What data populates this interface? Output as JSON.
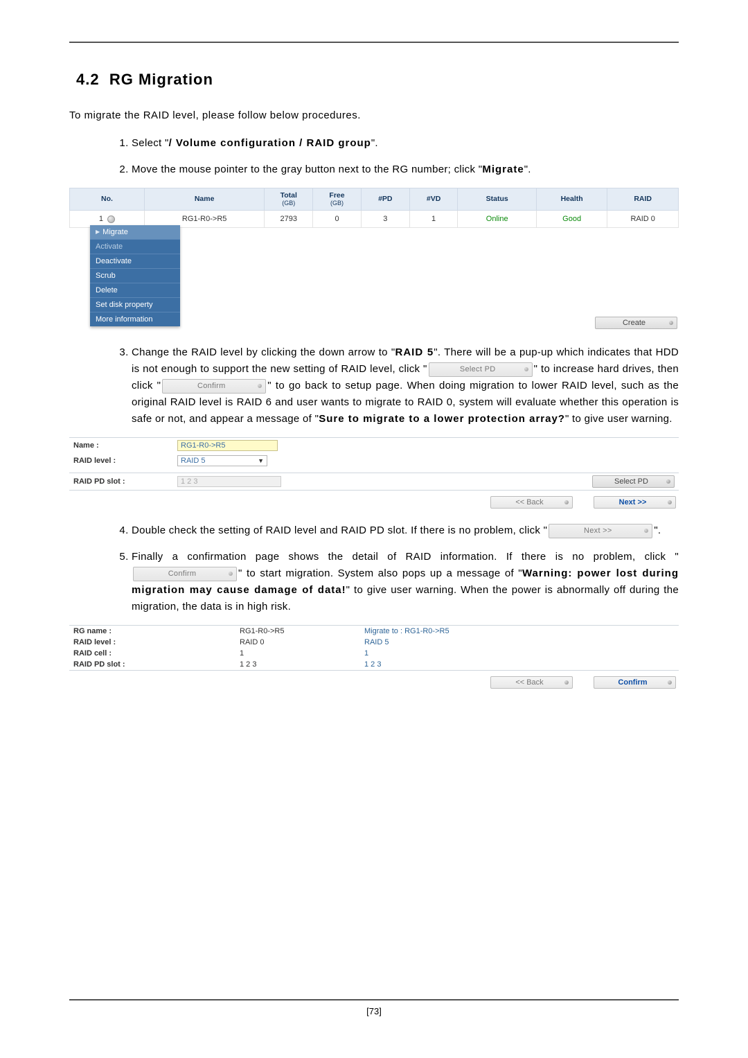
{
  "page_number": "[73]",
  "section": {
    "number": "4.2",
    "title": "RG Migration"
  },
  "intro": "To migrate the RAID level, please follow below procedures.",
  "steps": {
    "s1": {
      "pre": "Select \"",
      "path": "/ Volume configuration / RAID group",
      "post": "\"."
    },
    "s2": {
      "pre": "Move the mouse pointer to the gray button next to the RG number; click \"",
      "word": "Migrate",
      "post": "\"."
    },
    "s3": {
      "text_a": "Change the RAID level by clicking the down arrow to \"",
      "raid5": "RAID 5",
      "text_b": "\". There will be a pup-up which indicates that HDD is not enough to support the new setting of RAID level, click \"",
      "text_c": "\" to increase hard drives, then click \"",
      "text_d": "\" to go back to setup page. When doing migration to lower RAID level, such as the original RAID level is RAID 6 and user wants to migrate to RAID 0, system will evaluate whether this operation is safe or not, and appear a message of \"",
      "warn": "Sure to migrate to a lower protection array?",
      "text_e": "\" to give user warning."
    },
    "s4": {
      "text_a": "Double check the setting of RAID level and RAID PD slot. If there is no problem, click \"",
      "text_b": "\"."
    },
    "s5": {
      "text_a": "Finally a confirmation page shows the detail of RAID information. If there is no problem, click \"",
      "text_b": "\" to start migration. System also pops up a message of \"",
      "warn": "Warning: power lost during migration may cause damage of data!",
      "text_c": "\" to give user warning. When the power is abnormally off during the migration, the data is in high risk."
    }
  },
  "inline_buttons": {
    "select_pd": "Select PD",
    "confirm": "Confirm",
    "next": "Next >>"
  },
  "table": {
    "headers": {
      "no": "No.",
      "name": "Name",
      "total": "Total",
      "total_sub": "(GB)",
      "free": "Free",
      "free_sub": "(GB)",
      "pd": "#PD",
      "vd": "#VD",
      "status": "Status",
      "health": "Health",
      "raid": "RAID"
    },
    "rows": [
      {
        "no": "1",
        "name": "RG1-R0->R5",
        "total": "2793",
        "free": "0",
        "pd": "3",
        "vd": "1",
        "status": "Online",
        "health": "Good",
        "raid": "RAID 0"
      }
    ],
    "create_btn": "Create"
  },
  "context_menu": {
    "items": [
      {
        "label": "Migrate",
        "tri": true,
        "state": "normal"
      },
      {
        "label": "Activate",
        "state": "disabled"
      },
      {
        "label": "Deactivate",
        "state": "normal"
      },
      {
        "label": "Scrub",
        "state": "normal"
      },
      {
        "label": "Delete",
        "state": "normal"
      },
      {
        "label": "Set disk property",
        "state": "normal"
      },
      {
        "label": "More information",
        "state": "normal"
      }
    ]
  },
  "form1": {
    "name_label": "Name :",
    "name_val": "RG1-R0->R5",
    "raid_label": "RAID level :",
    "raid_val": "RAID 5",
    "slot_label": "RAID PD slot :",
    "slot_val": "1 2 3",
    "select_pd_btn": "Select PD",
    "back_btn": "<< Back",
    "next_btn": "Next >>"
  },
  "confirm": {
    "rows": [
      {
        "label": "RG name :",
        "cur": "RG1-R0->R5",
        "new": "Migrate to : RG1-R0->R5"
      },
      {
        "label": "RAID level :",
        "cur": "RAID 0",
        "new": "RAID 5"
      },
      {
        "label": "RAID cell :",
        "cur": "1",
        "new": "1"
      },
      {
        "label": "RAID PD slot :",
        "cur": "1 2 3",
        "new": "1 2 3"
      }
    ],
    "back_btn": "<< Back",
    "confirm_btn": "Confirm"
  }
}
